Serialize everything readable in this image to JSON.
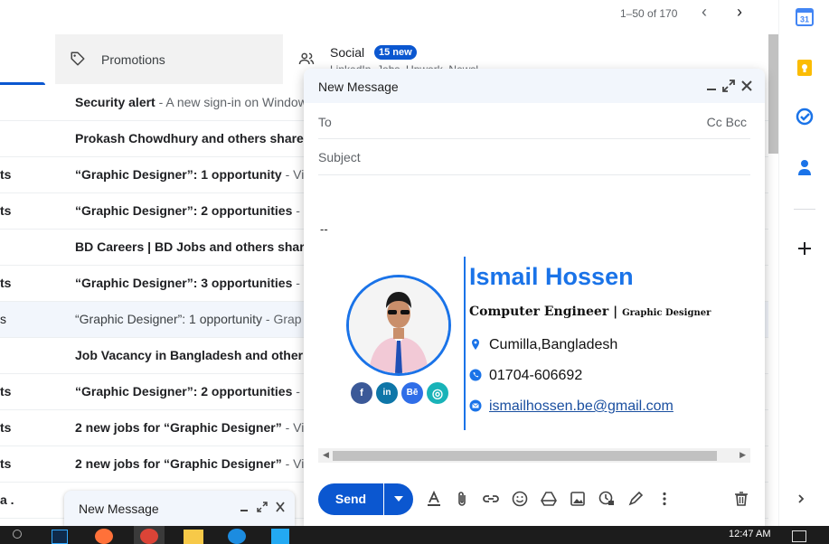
{
  "pagination": {
    "range": "1–50 of 170"
  },
  "tabs": {
    "promotions": {
      "label": "Promotions"
    },
    "social": {
      "label": "Social",
      "badge": "15 new",
      "sub": "LinkedIn, Jobs, Upwork, Newsl..."
    }
  },
  "rows": [
    {
      "left": "",
      "subject": "Security alert",
      "snippet": " - A new sign-in on Windows",
      "read": false
    },
    {
      "left": "",
      "subject": "Prokash Chowdhury and others share",
      "snippet": "",
      "read": false
    },
    {
      "left": "ts",
      "subject": "“Graphic Designer”: 1 opportunity",
      "snippet": " - Vi",
      "read": false
    },
    {
      "left": "ts",
      "subject": "“Graphic Designer”: 2 opportunities",
      "snippet": " - ",
      "read": false
    },
    {
      "left": "",
      "subject": "BD Careers | BD Jobs and others share",
      "snippet": "",
      "read": false
    },
    {
      "left": "ts",
      "subject": "“Graphic Designer”: 3 opportunities",
      "snippet": " - ",
      "read": false
    },
    {
      "left": "s",
      "subject": "“Graphic Designer”: 1 opportunity",
      "snippet": " - Grap",
      "read": true
    },
    {
      "left": "",
      "subject": "Job Vacancy in Bangladesh and other",
      "snippet": "",
      "read": false
    },
    {
      "left": "ts",
      "subject": "“Graphic Designer”: 2 opportunities",
      "snippet": " - ",
      "read": false
    },
    {
      "left": "ts",
      "subject": "2 new jobs for “Graphic Designer”",
      "snippet": " - Vi",
      "read": false
    },
    {
      "left": "ts",
      "subject": "2 new jobs for “Graphic Designer”",
      "snippet": " - Vi",
      "read": false
    },
    {
      "left": "a .",
      "subject": "",
      "snippet": "",
      "read": false
    }
  ],
  "compose": {
    "title": "New Message",
    "to_label": "To",
    "cc_bcc": "Cc Bcc",
    "subject_placeholder": "Subject",
    "sig_dash": "--",
    "send_label": "Send"
  },
  "signature": {
    "name": "Ismail Hossen",
    "title_main": "Computer Engineer",
    "title_sep": " | ",
    "title_sub": "Graphic Designer",
    "location": "Cumilla,Bangladesh",
    "phone": "01704-606692",
    "email": "ismailhossen.be@gmail.com",
    "social": [
      "f",
      "in",
      "Bē",
      "◎"
    ],
    "accent": "#1a73e8"
  },
  "mini_compose": {
    "title": "New Message"
  },
  "taskbar": {
    "time": "12:47 AM"
  }
}
